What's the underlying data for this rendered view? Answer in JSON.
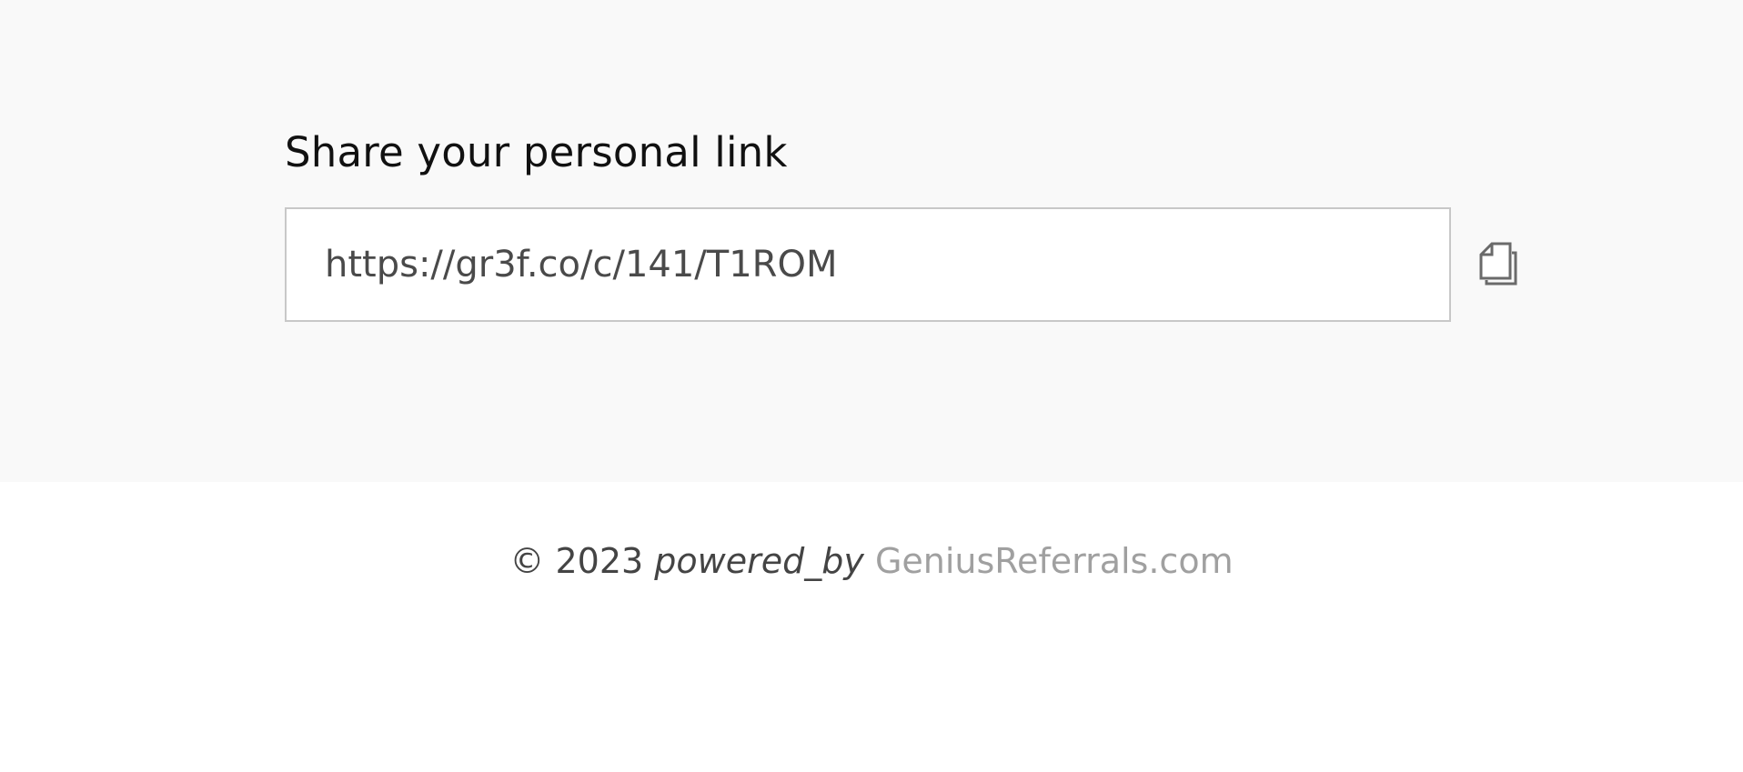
{
  "share": {
    "heading": "Share your personal link",
    "link_value": "https://gr3f.co/c/141/T1ROM",
    "copy_icon": "copy-icon"
  },
  "footer": {
    "copyright": "© 2023",
    "powered_by": "powered_by",
    "brand": "GeniusReferrals.com"
  },
  "colors": {
    "section_background": "#f9f9f9",
    "page_background": "#ffffff",
    "brand_link": "#a0a0a0"
  }
}
